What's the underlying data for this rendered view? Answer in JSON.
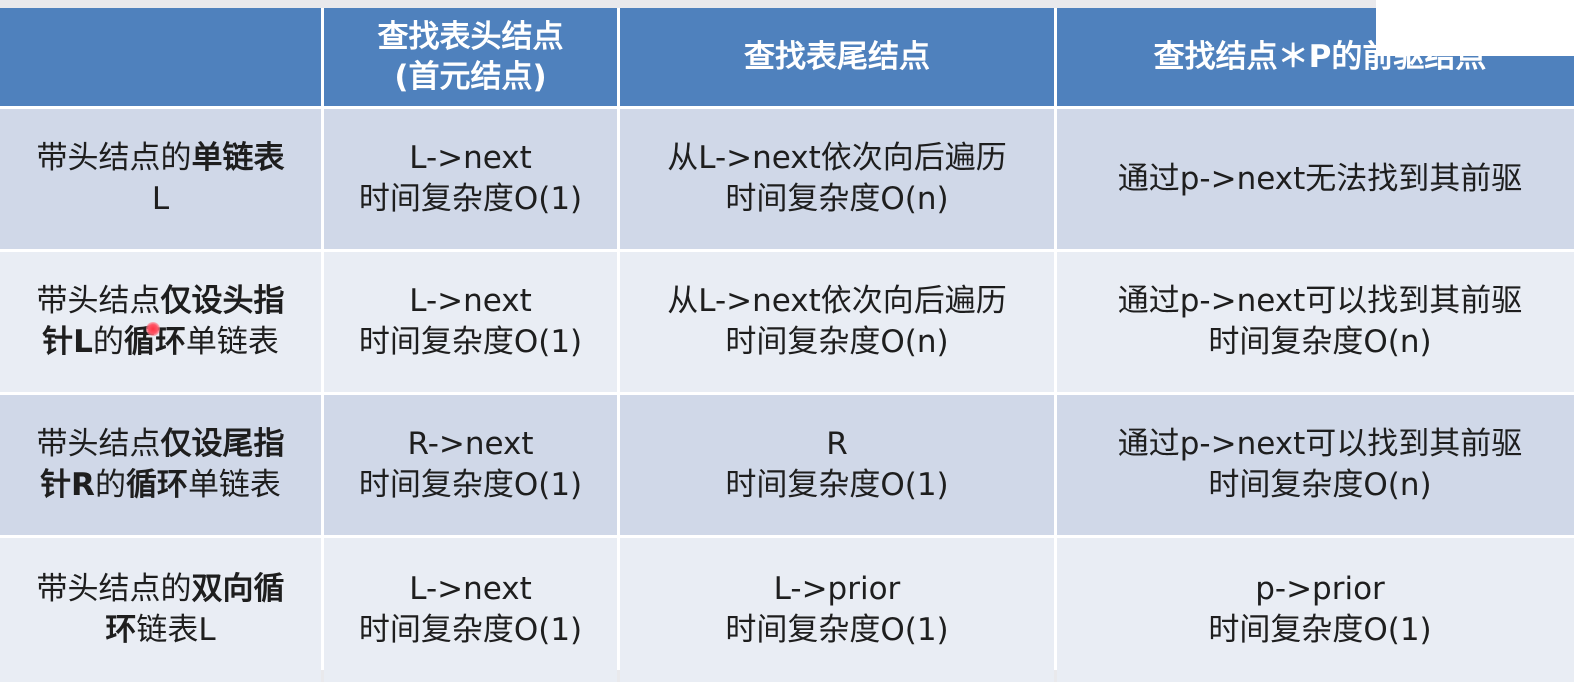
{
  "table": {
    "headers": [
      "",
      [
        "查找表头结点",
        "(首元结点)"
      ],
      [
        "查找表尾结点"
      ],
      [
        "查找结点＊P的前驱结点"
      ]
    ],
    "rows": [
      {
        "label": [
          [
            {
              "t": "带头结点的",
              "b": false
            },
            {
              "t": "单链表",
              "b": true
            }
          ],
          [
            {
              "t": "L",
              "b": false
            }
          ]
        ],
        "cells": [
          [
            "L->next",
            "时间复杂度O(1)"
          ],
          [
            "从L->next依次向后遍历",
            "时间复杂度O(n)"
          ],
          [
            "通过p->next无法找到其前驱"
          ]
        ]
      },
      {
        "label": [
          [
            {
              "t": "带头结点",
              "b": false
            },
            {
              "t": "仅设头指",
              "b": true
            }
          ],
          [
            {
              "t": "针L",
              "b": true
            },
            {
              "t": "的",
              "b": false
            },
            {
              "t": "循环",
              "b": true
            },
            {
              "t": "单链表",
              "b": false
            }
          ]
        ],
        "cells": [
          [
            "L->next",
            "时间复杂度O(1)"
          ],
          [
            "从L->next依次向后遍历",
            "时间复杂度O(n)"
          ],
          [
            "通过p->next可以找到其前驱",
            "时间复杂度O(n)"
          ]
        ]
      },
      {
        "label": [
          [
            {
              "t": "带头结点",
              "b": false
            },
            {
              "t": "仅设尾指",
              "b": true
            }
          ],
          [
            {
              "t": "针R",
              "b": true
            },
            {
              "t": "的",
              "b": false
            },
            {
              "t": "循环",
              "b": true
            },
            {
              "t": "单链表",
              "b": false
            }
          ]
        ],
        "cells": [
          [
            "R->next",
            "时间复杂度O(1)"
          ],
          [
            "R",
            "时间复杂度O(1)"
          ],
          [
            "通过p->next可以找到其前驱",
            "时间复杂度O(n)"
          ]
        ]
      },
      {
        "label": [
          [
            {
              "t": "带头结点的",
              "b": false
            },
            {
              "t": "双向循",
              "b": true
            }
          ],
          [
            {
              "t": "环",
              "b": true
            },
            {
              "t": "链表L",
              "b": false
            }
          ]
        ],
        "cells": [
          [
            "L->next",
            "时间复杂度O(1)"
          ],
          [
            "L->prior",
            "时间复杂度O(1)"
          ],
          [
            "p->prior",
            "时间复杂度O(1)"
          ]
        ]
      }
    ]
  },
  "colors": {
    "header_bg": "#4f81bd",
    "row_odd_bg": "#d0d8e8",
    "row_even_bg": "#e9edf4",
    "laser_pointer": "#ff3344"
  }
}
